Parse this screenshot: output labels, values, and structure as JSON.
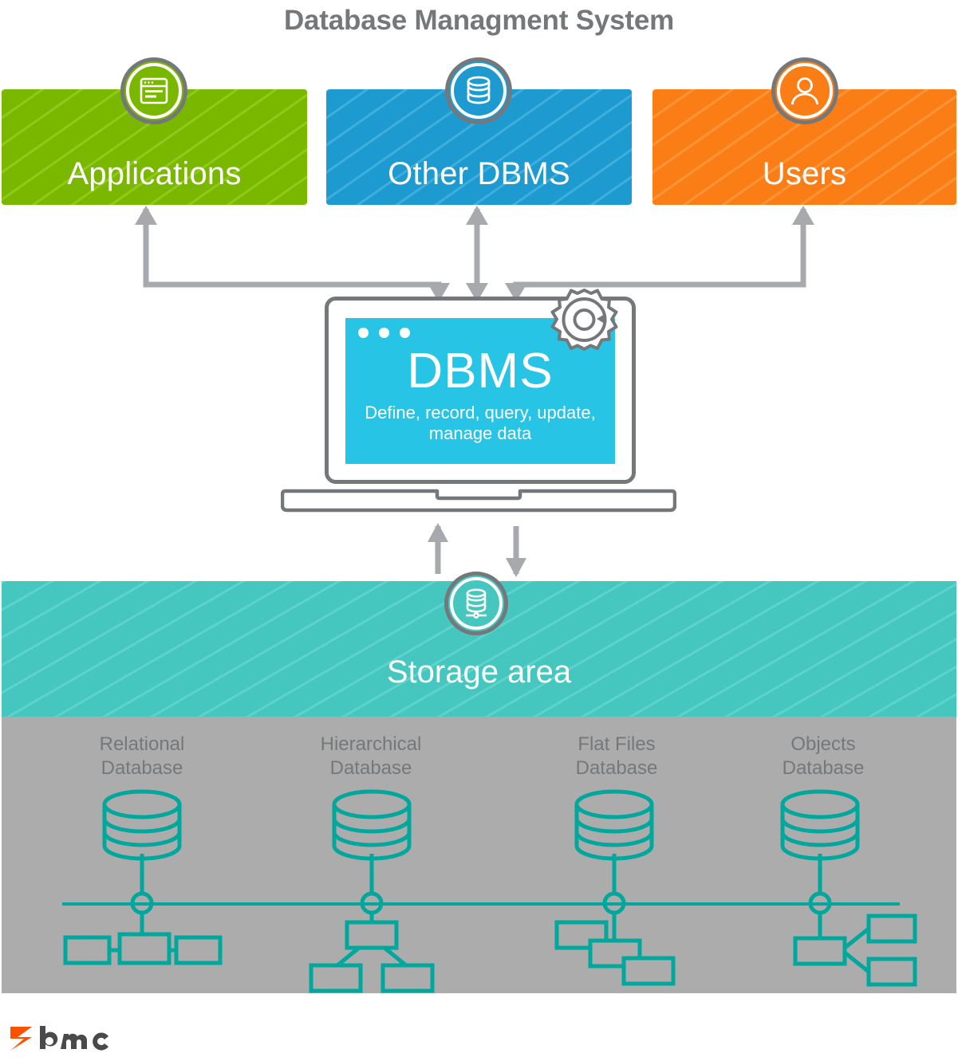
{
  "title": "Database Managment System",
  "colors": {
    "applications": "#7AB800",
    "other_dbms": "#1D9BD1",
    "users": "#FB7D16",
    "dbms_screen": "#27C4E5",
    "storage": "#45C6BE",
    "db_area": "#ACACAC",
    "outline_gray": "#75787B",
    "arrow_gray": "#A7A9AC",
    "db_teal": "#00A79D",
    "bmc_orange": "#FE5000",
    "bmc_text": "#4A4A4A"
  },
  "sources": [
    {
      "label": "Applications",
      "icon": "browser-window-icon",
      "color": "#7AB800"
    },
    {
      "label": "Other DBMS",
      "icon": "database-cylinder-icon",
      "color": "#1D9BD1"
    },
    {
      "label": "Users",
      "icon": "user-person-icon",
      "color": "#FB7D16"
    }
  ],
  "dbms": {
    "title": "DBMS",
    "subtitle": "Define, record, query,\nupdate, manage data",
    "gear_icon": "gear-refresh-icon",
    "window_dots": 3
  },
  "storage": {
    "label": "Storage area",
    "icon": "database-network-icon"
  },
  "databases": [
    {
      "label": "Relational\nDatabase",
      "diagram": "linear-chain"
    },
    {
      "label": "Hierarchical\nDatabase",
      "diagram": "tree"
    },
    {
      "label": "Flat Files\nDatabase",
      "diagram": "stacked-cascade"
    },
    {
      "label": "Objects\nDatabase",
      "diagram": "branching-right"
    }
  ],
  "footer": {
    "logo_text": "bmc",
    "logo_icon": "bmc-ribbon-icon"
  }
}
